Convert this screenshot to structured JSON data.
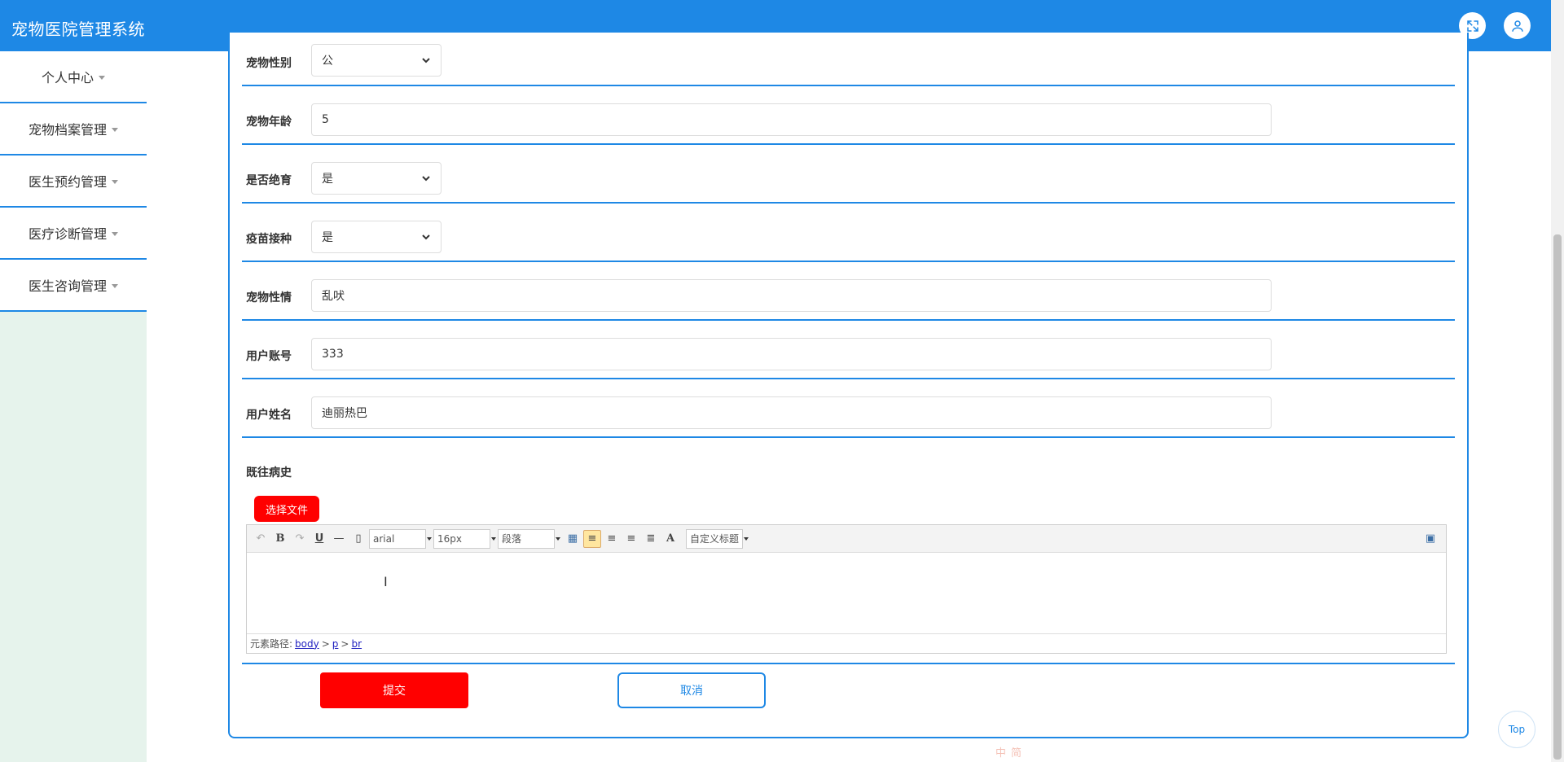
{
  "app": {
    "title": "宠物医院管理系统"
  },
  "sidebar": {
    "items": [
      {
        "label": "个人中心"
      },
      {
        "label": "宠物档案管理"
      },
      {
        "label": "医生预约管理"
      },
      {
        "label": "医疗诊断管理"
      },
      {
        "label": "医生咨询管理"
      }
    ]
  },
  "form": {
    "pet_gender": {
      "label": "宠物性别",
      "value": "公"
    },
    "pet_age": {
      "label": "宠物年龄",
      "value": "5"
    },
    "neutered": {
      "label": "是否绝育",
      "value": "是"
    },
    "vaccinated": {
      "label": "疫苗接种",
      "value": "是"
    },
    "temperament": {
      "label": "宠物性情",
      "value": "乱吠"
    },
    "user_account": {
      "label": "用户账号",
      "value": "333"
    },
    "user_name": {
      "label": "用户姓名",
      "value": "迪丽热巴"
    },
    "history": {
      "label": "既往病史"
    },
    "choose_file_label": "选择文件"
  },
  "editor": {
    "font_family": "arial",
    "font_size": "16px",
    "paragraph": "段落",
    "custom_title": "自定义标题",
    "path_label": "元素路径:",
    "path": [
      "body",
      "p",
      "br"
    ]
  },
  "actions": {
    "submit": "提交",
    "cancel": "取消"
  },
  "top_button": "Top",
  "colors": {
    "primary": "#1e88e5",
    "danger": "#ff0000",
    "sidebar_bg": "#e6f3ec"
  },
  "ime": [
    "中",
    "简"
  ]
}
